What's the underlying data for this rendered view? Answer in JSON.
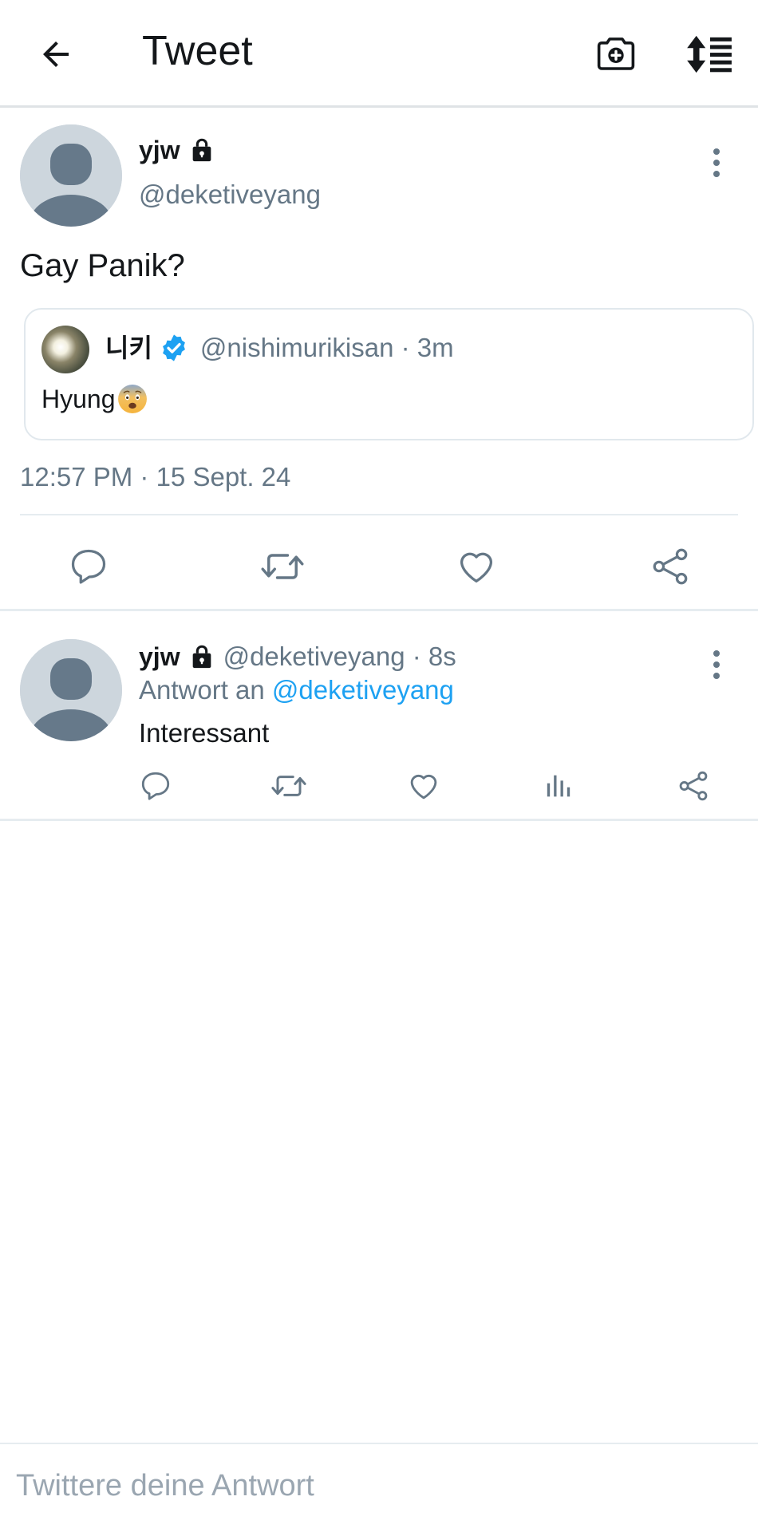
{
  "header": {
    "title": "Tweet",
    "back_icon": "arrow-left-icon",
    "camera_icon": "camera-plus-icon",
    "sort_icon": "sort-list-icon"
  },
  "main_tweet": {
    "display_name": "yjw",
    "protected_icon": "lock-icon",
    "handle": "@deketiveyang",
    "text": "Gay Panik?",
    "quote": {
      "display_name": "니키",
      "verified_icon": "verified-badge-icon",
      "handle_time": "@nishimurikisan · 3m",
      "text": "Hyung",
      "emoji": "fearful-face-emoji"
    },
    "timestamp": "12:57 PM · 15 Sept. 24",
    "actions": [
      "reply-icon",
      "retweet-icon",
      "like-icon",
      "share-icon"
    ]
  },
  "reply_tweet": {
    "display_name": "yjw",
    "protected_icon": "lock-icon",
    "handle_time": "@deketiveyang · 8s",
    "reply_prefix": "Antwort an",
    "reply_mention": "@deketiveyang",
    "text": "Interessant",
    "actions": [
      "reply-icon",
      "retweet-icon",
      "like-icon",
      "stats-icon",
      "share-icon"
    ]
  },
  "compose": {
    "placeholder": "Twittere deine Antwort"
  },
  "colors": {
    "accent": "#1da1f2",
    "secondary_text": "#657786",
    "primary_text": "#14171a",
    "divider": "#e6ecf0"
  }
}
